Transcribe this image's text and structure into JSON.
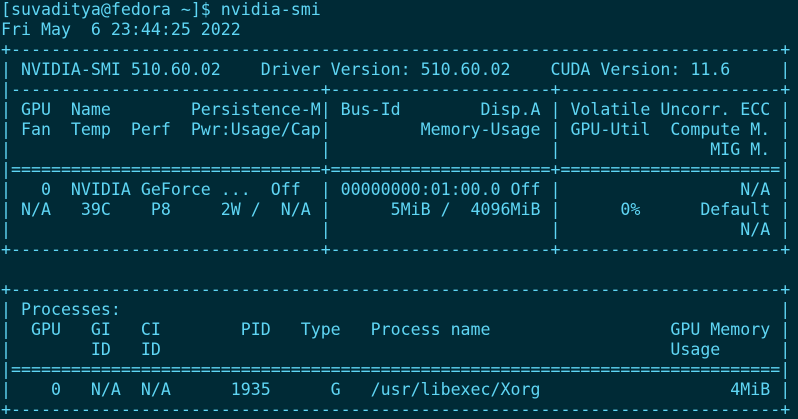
{
  "terminal": {
    "prompt": "[suvaditya@fedora ~]$ nvidia-smi",
    "date": "Fri May  6 23:44:25 2022",
    "output": [
      "+-----------------------------------------------------------------------------+",
      "| NVIDIA-SMI 510.60.02    Driver Version: 510.60.02    CUDA Version: 11.6     |",
      "|-------------------------------+----------------------+----------------------+",
      "| GPU  Name        Persistence-M| Bus-Id        Disp.A | Volatile Uncorr. ECC |",
      "| Fan  Temp  Perf  Pwr:Usage/Cap|         Memory-Usage | GPU-Util  Compute M. |",
      "|                               |                      |               MIG M. |",
      "|===============================+======================+======================|",
      "|   0  NVIDIA GeForce ...  Off  | 00000000:01:00.0 Off |                  N/A |",
      "| N/A   39C    P8     2W /  N/A |      5MiB /  4096MiB |      0%      Default |",
      "|                               |                      |                  N/A |",
      "+-------------------------------+----------------------+----------------------+",
      "                                                                               ",
      "+-----------------------------------------------------------------------------+",
      "| Processes:                                                                  |",
      "|  GPU   GI   CI        PID   Type   Process name                  GPU Memory |",
      "|        ID   ID                                                   Usage      |",
      "|=============================================================================|",
      "|    0   N/A  N/A      1935      G   /usr/libexec/Xorg                   4MiB |",
      "+-----------------------------------------------------------------------------+"
    ]
  },
  "colors": {
    "background": "#002a36",
    "foreground": "#5fd6f5"
  }
}
